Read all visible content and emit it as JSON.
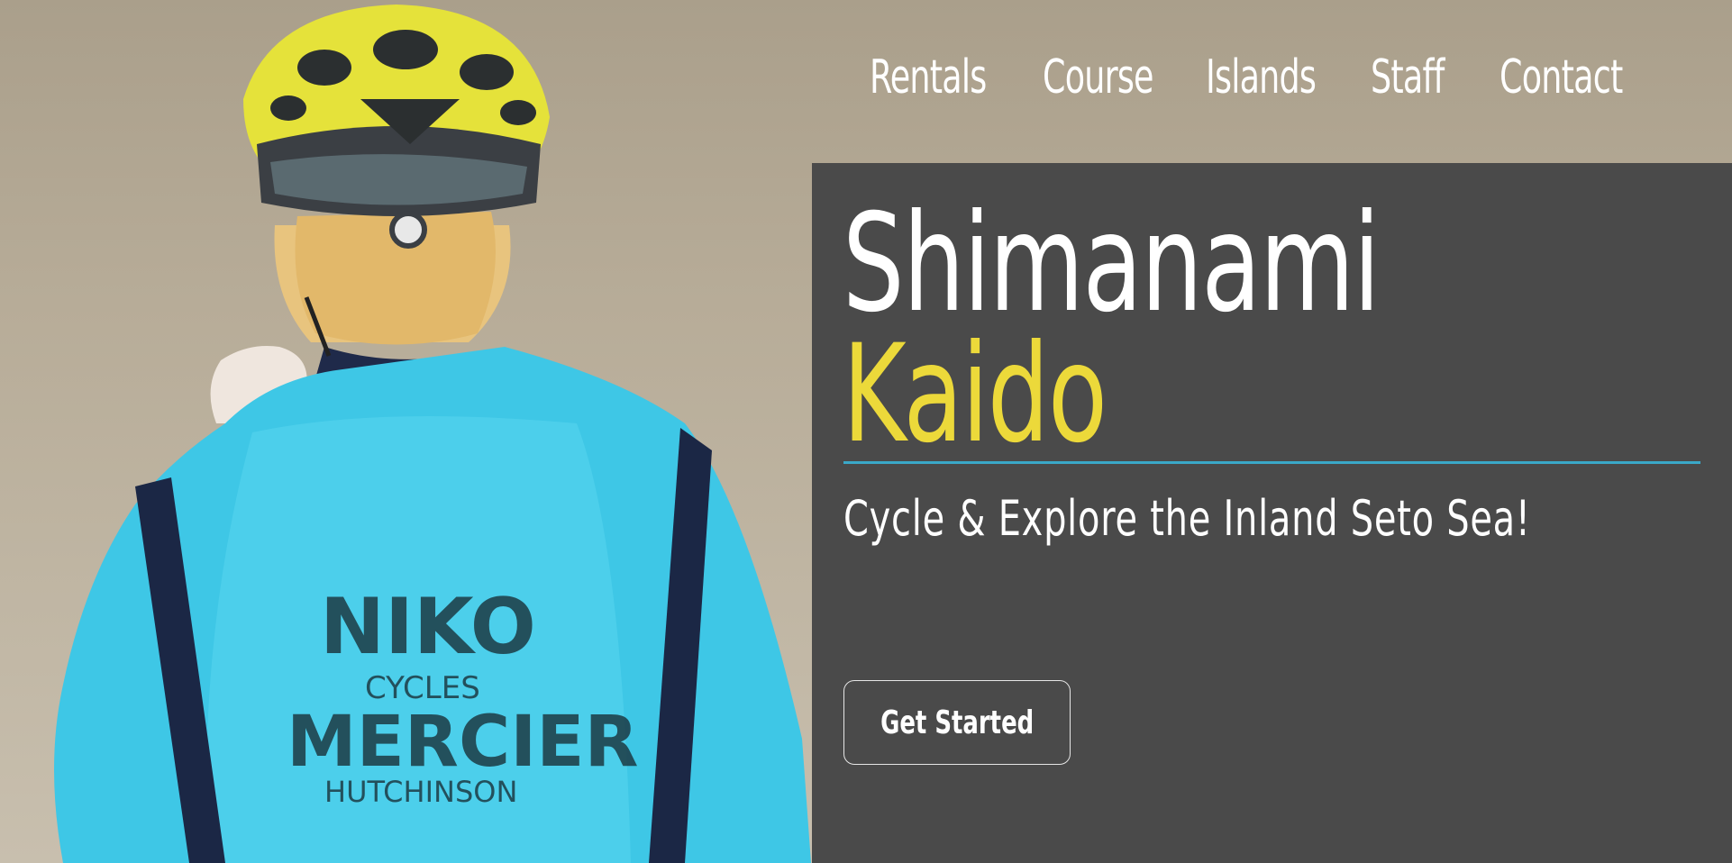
{
  "nav": {
    "items": [
      {
        "label": "Rentals"
      },
      {
        "label": "Course"
      },
      {
        "label": "Islands"
      },
      {
        "label": "Staff"
      },
      {
        "label": "Contact"
      }
    ]
  },
  "hero": {
    "title_line1": "Shimanami",
    "title_line2": "Kaido",
    "subtitle": "Cycle & Explore the Inland Seto Sea!",
    "cta_label": "Get Started",
    "photo": {
      "jacket_text": [
        "NIKO",
        "CYCLES",
        "MERCIER",
        "HUTCHINSON"
      ]
    }
  },
  "colors": {
    "panel": "#4a4a4a",
    "accent_yellow": "#ecd93a",
    "divider_blue": "#3aa8c8",
    "text": "#ffffff"
  }
}
